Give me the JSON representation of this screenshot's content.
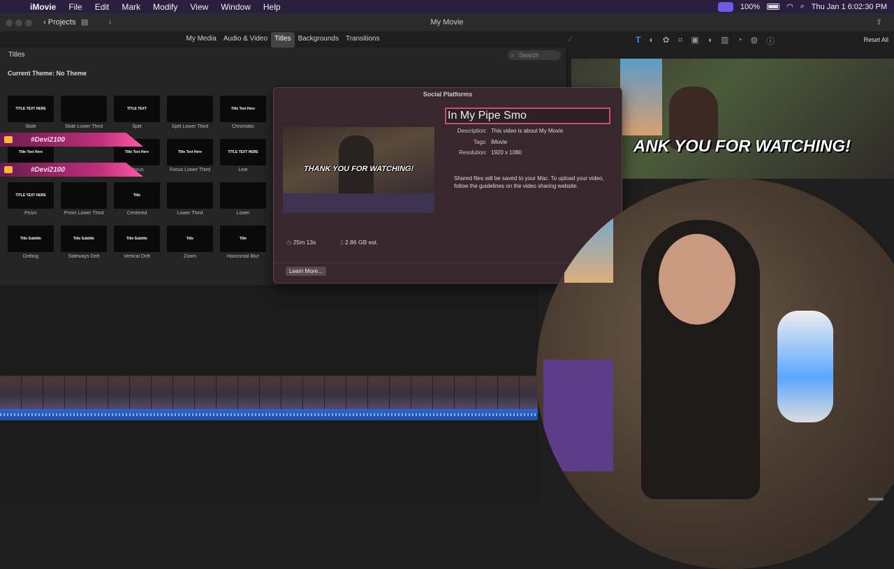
{
  "menubar": {
    "apple": "",
    "items": [
      "iMovie",
      "File",
      "Edit",
      "Mark",
      "Modify",
      "View",
      "Window",
      "Help"
    ],
    "battery": "100%",
    "clock": "Thu Jan 1  6:02:30 PM"
  },
  "window": {
    "title": "My Movie",
    "projects_label": "Projects"
  },
  "browser_tabs": [
    "My Media",
    "Audio & Video",
    "Titles",
    "Backgrounds",
    "Transitions"
  ],
  "active_tab": "Titles",
  "reset_all_label": "Reset All",
  "titles_panel": {
    "header": "Titles",
    "search_placeholder": "Search",
    "theme_label": "Current Theme: No Theme",
    "tiles": [
      {
        "caption": "Slide",
        "preview": "TITLE TEXT HERE"
      },
      {
        "caption": "Slide Lower Third",
        "preview": ""
      },
      {
        "caption": "Split",
        "preview": "TITLE TEXT"
      },
      {
        "caption": "Split Lower Third",
        "preview": ""
      },
      {
        "caption": "Chromatic",
        "preview": "Title Text Here"
      },
      {
        "caption": "",
        "preview": "Title Text Here"
      },
      {
        "caption": "Focus",
        "preview": "Title Text Here"
      },
      {
        "caption": "Focus Lower Third",
        "preview": "Title Text Here"
      },
      {
        "caption": "Line",
        "preview": "TITLE TEXT HERE"
      },
      {
        "caption": "Prism",
        "preview": "TITLE TEXT HERE"
      },
      {
        "caption": "Prism Lower Third",
        "preview": ""
      },
      {
        "caption": "Centered",
        "preview": "Title"
      },
      {
        "caption": "Lower Third",
        "preview": ""
      },
      {
        "caption": "Lower",
        "preview": ""
      },
      {
        "caption": "Drifting",
        "preview": "Title Subtitle"
      },
      {
        "caption": "Sideways Drift",
        "preview": "Title Subtitle"
      },
      {
        "caption": "Vertical Drift",
        "preview": "Title Subtitle"
      },
      {
        "caption": "Zoom",
        "preview": "Title"
      },
      {
        "caption": "Horizontal Blur",
        "preview": "Title"
      }
    ]
  },
  "overlay_banners": [
    "#Devi2100",
    "#Devi2100"
  ],
  "share_dialog": {
    "title": "Social Platforms",
    "name_value": "In My Pipe Smo",
    "description_label": "Description:",
    "description_value": "This video is about My Movie",
    "tags_label": "Tags:",
    "tags_value": "iMovie",
    "resolution_label": "Resolution:",
    "resolution_value": "1920 x 1080",
    "thumb_caption": "THANK YOU FOR WATCHING!",
    "note": "Shared files will be saved to your Mac. To upload your video, follow the guidelines on the video sharing website.",
    "duration": "25m 13s",
    "size": "2.86 GB est.",
    "learn_more_label": "Learn More..."
  },
  "viewer": {
    "overlay_text": "ANK YOU FOR WATCHING!"
  },
  "icons": {
    "viewer_tools": [
      "text-icon",
      "color-icon",
      "palette-icon",
      "crop-icon",
      "camera-icon",
      "volume-icon",
      "equalizer-icon",
      "speed-icon",
      "filter-icon",
      "info-icon"
    ]
  }
}
